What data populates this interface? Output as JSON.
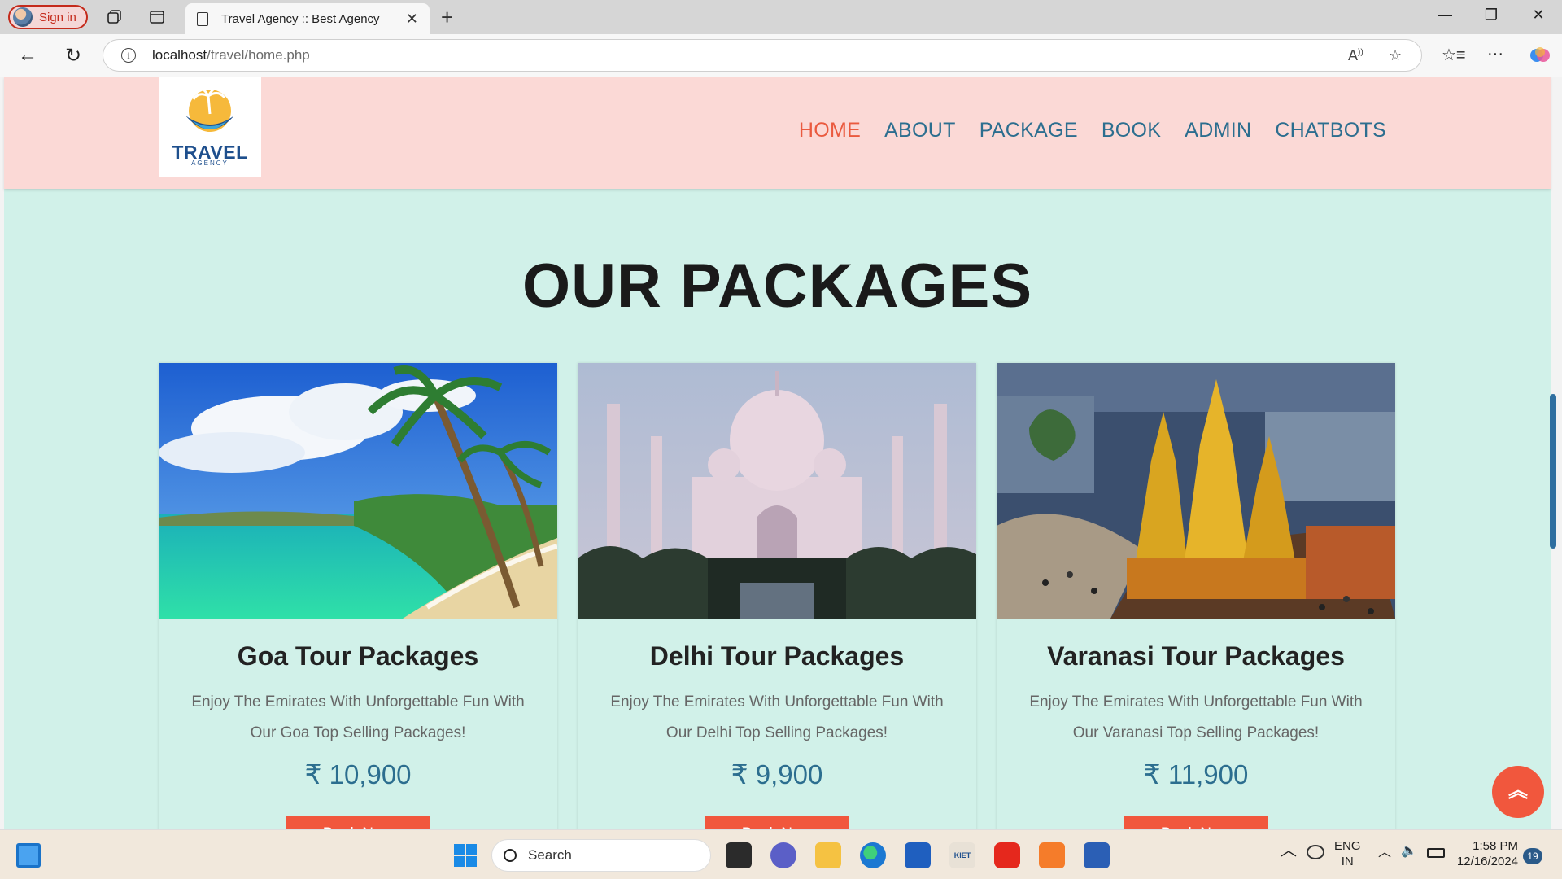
{
  "browser": {
    "signin_label": "Sign in",
    "tab_title": "Travel Agency :: Best Agency",
    "url_host": "localhost",
    "url_path": "/travel/home.php"
  },
  "site": {
    "logo_text": "TRAVEL",
    "logo_subtext": "AGENCY",
    "nav": [
      {
        "label": "HOME",
        "active": true
      },
      {
        "label": "ABOUT"
      },
      {
        "label": "PACKAGE"
      },
      {
        "label": "BOOK"
      },
      {
        "label": "ADMIN"
      },
      {
        "label": "CHATBOTS"
      }
    ],
    "heading": "OUR PACKAGES",
    "packages": [
      {
        "title": "Goa Tour Packages",
        "description": "Enjoy The Emirates With Unforgettable Fun With Our Goa Top Selling Packages!",
        "price": "₹ 10,900",
        "button": "Book Now"
      },
      {
        "title": "Delhi Tour Packages",
        "description": "Enjoy The Emirates With Unforgettable Fun With Our Delhi Top Selling Packages!",
        "price": "₹ 9,900",
        "button": "Book Now"
      },
      {
        "title": "Varanasi Tour Packages",
        "description": "Enjoy The Emirates With Unforgettable Fun With Our Varanasi Top Selling Packages!",
        "price": "₹ 11,900",
        "button": "Book Now"
      }
    ],
    "accent_color": "#f1573d",
    "nav_color": "#2c6e8f"
  },
  "taskbar": {
    "search_label": "Search",
    "lang_line1": "ENG",
    "lang_line2": "IN",
    "time": "1:58 PM",
    "date": "12/16/2024",
    "notification_count": "19"
  }
}
